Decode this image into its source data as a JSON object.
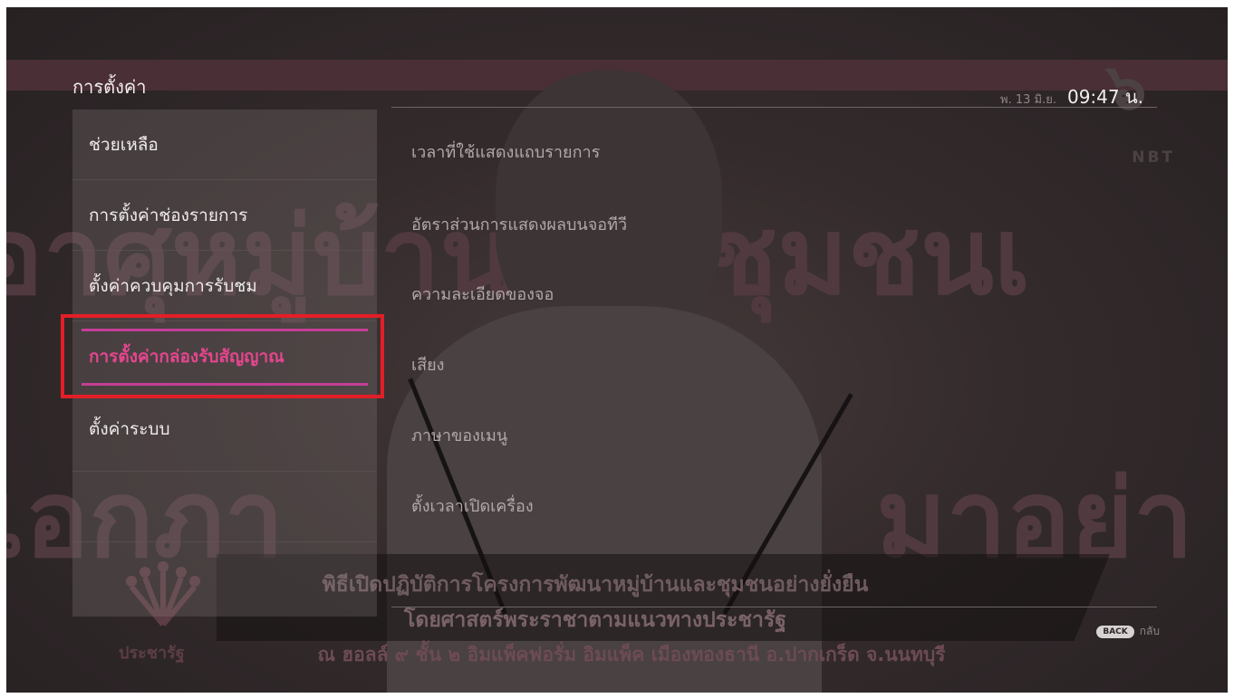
{
  "header": {
    "title": "การตั้งค่า",
    "date": "พ. 13 มิ.ย.",
    "time": "09:47 น."
  },
  "menu": {
    "items": [
      {
        "label": "ช่วยเหลือ"
      },
      {
        "label": "การตั้งค่าช่องรายการ"
      },
      {
        "label": "ตั้งค่าควบคุมการรับชม"
      },
      {
        "label": "การตั้งค่ากล่องรับสัญญาณ",
        "selected": true
      },
      {
        "label": "ตั้งค่าระบบ"
      }
    ]
  },
  "submenu": {
    "items": [
      {
        "label": "เวลาที่ใช้แสดงแถบรายการ"
      },
      {
        "label": "อัตราส่วนการแสดงผลบนจอทีวี"
      },
      {
        "label": "ความละเอียดของจอ"
      },
      {
        "label": "เสียง"
      },
      {
        "label": "ภาษาของเมนู"
      },
      {
        "label": "ตั้งเวลาเปิดเครื่อง"
      }
    ]
  },
  "footer": {
    "back_key": "BACK",
    "back_label": "กลับ"
  },
  "background": {
    "caption_line1": "พิธีเปิดปฏิบัติการโครงการพัฒนาหมู่บ้านและชุมชนอย่างยั่งยืน",
    "caption_line2": "โดยศาสตร์พระราชาตามแนวทางประชารัฐ",
    "caption_line3": "ณ ฮอลล์ ๙ ชั้น ๒ อิมแพ็คฟอรั่ม อิมแพ็ค เมืองทองธานี อ.ปากเกร็ด จ.นนทบุรี",
    "banner_text_1": "อาศุหมู่บ้านและชุมชนเ",
    "banner_text_2": "เอกภา",
    "banner_text_3": "มาอย่า",
    "channel_logo": "๖",
    "channel_logo_sub": "NBT",
    "org_logo_text": "ประชารัฐ"
  },
  "colors": {
    "accent": "#e4468e",
    "highlight_border": "#e41e26",
    "selected_underline": "#c43e95"
  }
}
